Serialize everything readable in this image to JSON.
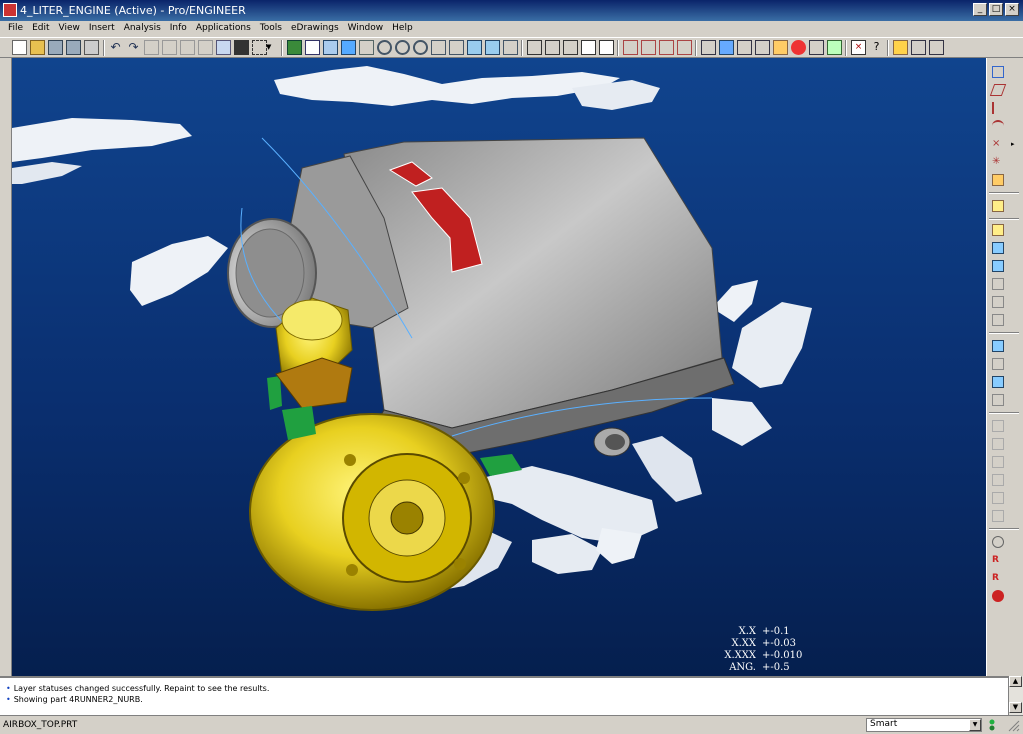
{
  "window": {
    "title": "4_LITER_ENGINE (Active) - Pro/ENGINEER"
  },
  "menu": {
    "items": [
      "File",
      "Edit",
      "View",
      "Insert",
      "Analysis",
      "Info",
      "Applications",
      "Tools",
      "eDrawings",
      "Window",
      "Help"
    ]
  },
  "tolerances": [
    {
      "label": "X.X",
      "value": "+-0.1"
    },
    {
      "label": "X.XX",
      "value": "+-0.03"
    },
    {
      "label": "X.XXX",
      "value": "+-0.010"
    },
    {
      "label": "ANG.",
      "value": "+-0.5"
    }
  ],
  "messages": [
    "Layer statuses changed successfully. Repaint to see the results.",
    "Showing part 4RUNNER2_NURB."
  ],
  "status": {
    "model_name": "AIRBOX_TOP.PRT",
    "filter_value": "Smart"
  },
  "colors": {
    "viewport_bg": "#0a2f70",
    "turbo": "#e8d820",
    "airbox": "#b8b8b8",
    "logo": "#c02020",
    "accent_green": "#20a040"
  }
}
